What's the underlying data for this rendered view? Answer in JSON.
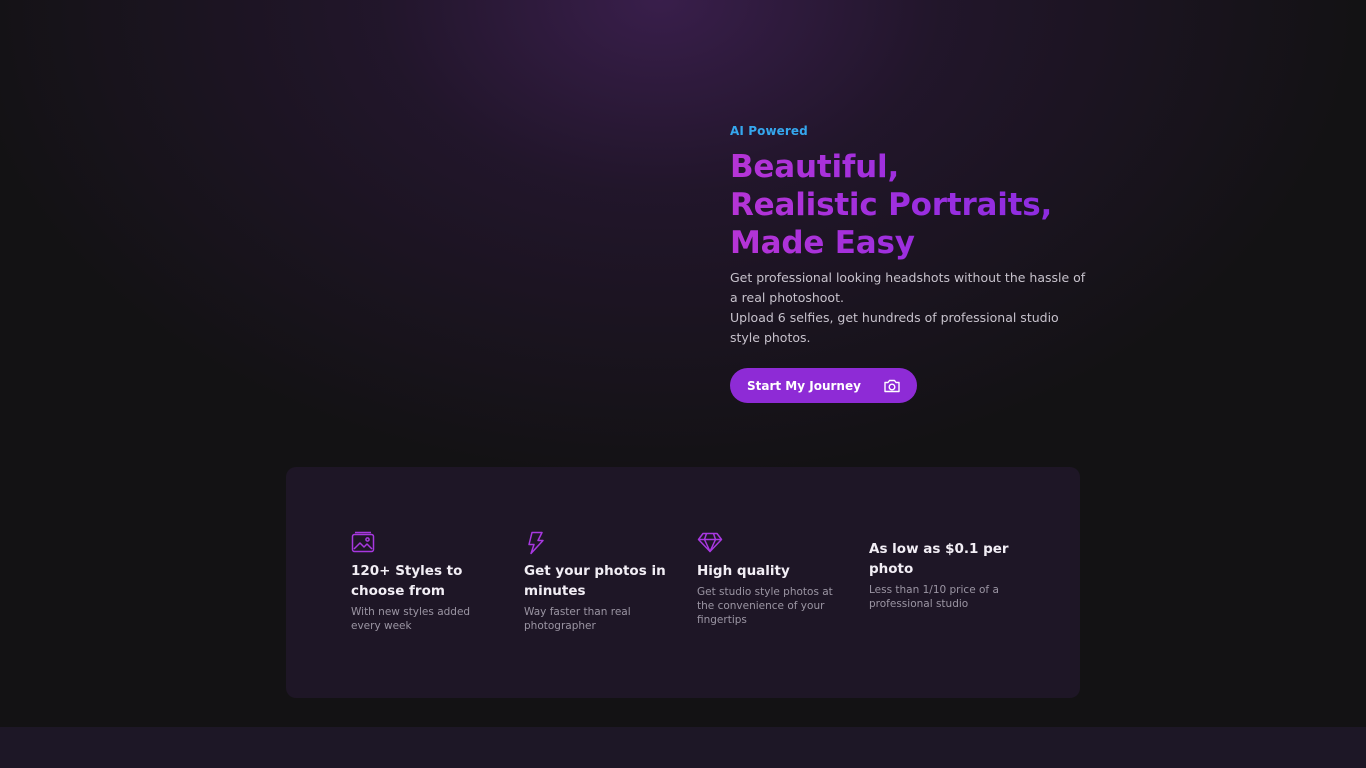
{
  "hero": {
    "eyebrow": "AI Powered",
    "headline": [
      "Beautiful,",
      "Realistic Portraits,",
      "Made Easy"
    ],
    "description": [
      "Get professional looking headshots without the hassle of a real photoshoot.",
      "Upload 6 selfies, get hundreds of professional studio style photos."
    ],
    "cta_label": "Start My Journey",
    "cta_icon": "camera-icon"
  },
  "features": [
    {
      "icon": "image-icon",
      "title": "120+ Styles to choose from",
      "subtitle": "With new styles added every week"
    },
    {
      "icon": "lightning-icon",
      "title": "Get your photos in minutes",
      "subtitle": "Way faster than real photographer"
    },
    {
      "icon": "diamond-icon",
      "title": "High quality",
      "subtitle": "Get studio style photos at the convenience of your fingertips"
    },
    {
      "icon": "",
      "title": "As low as $0.1 per photo",
      "subtitle": "Less than 1/10 price of a professional studio"
    }
  ],
  "colors": {
    "accent": "#8e2bd6",
    "eyebrow": "#35a7ee",
    "background": "#131214",
    "card": "#1e1626"
  }
}
